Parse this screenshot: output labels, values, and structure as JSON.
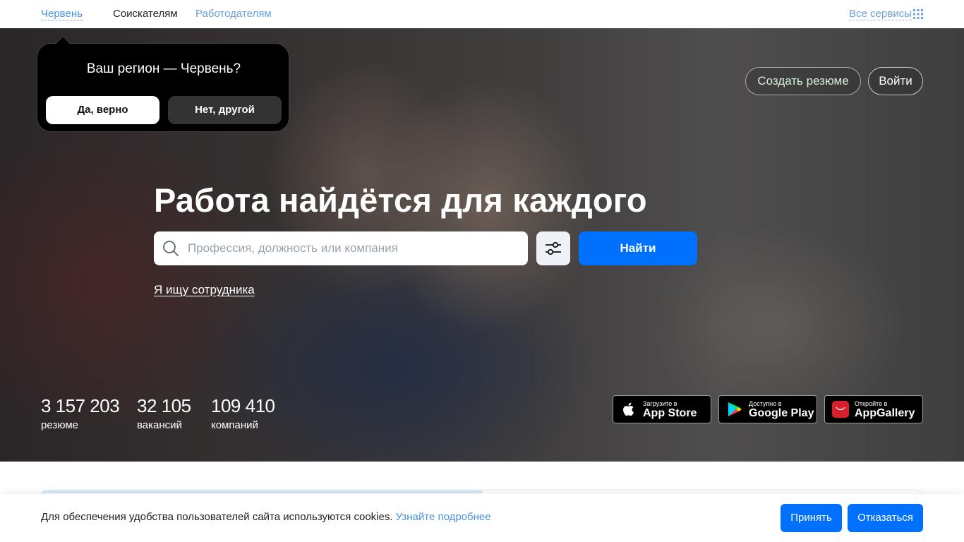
{
  "topbar": {
    "region_link": "Червень",
    "nav_seekers": "Соискателям",
    "nav_employers": "Работодателям",
    "all_services": "Все сервисы"
  },
  "hero": {
    "headline": "Работа найдётся для каждого",
    "search_placeholder": "Профессия, должность или компания",
    "search_value": "",
    "find_button": "Найти",
    "employer_link": "Я ищу сотрудника",
    "create_resume": "Создать резюме",
    "login": "Войти"
  },
  "region_popup": {
    "question": "Ваш регион — Червень?",
    "yes": "Да, верно",
    "no": "Нет, другой"
  },
  "stats": [
    {
      "value": "3 157 203",
      "label": "резюме"
    },
    {
      "value": "32 105",
      "label": "вакансий"
    },
    {
      "value": "109 410",
      "label": "компаний"
    }
  ],
  "app_badges": [
    {
      "small": "Загрузите в",
      "big": "App Store",
      "icon": "apple-icon"
    },
    {
      "small": "Доступно в",
      "big": "Google Play",
      "icon": "google-play-icon"
    },
    {
      "small": "Откройте в",
      "big": "AppGallery",
      "icon": "huawei-icon"
    }
  ],
  "cookie": {
    "text": "Для обеспечения удобства пользователей сайта используются cookies.",
    "more": "Узнайте подробнее",
    "accept": "Принять",
    "decline": "Отказаться"
  },
  "colors": {
    "accent": "#0070ff",
    "link": "#4a90e2"
  }
}
